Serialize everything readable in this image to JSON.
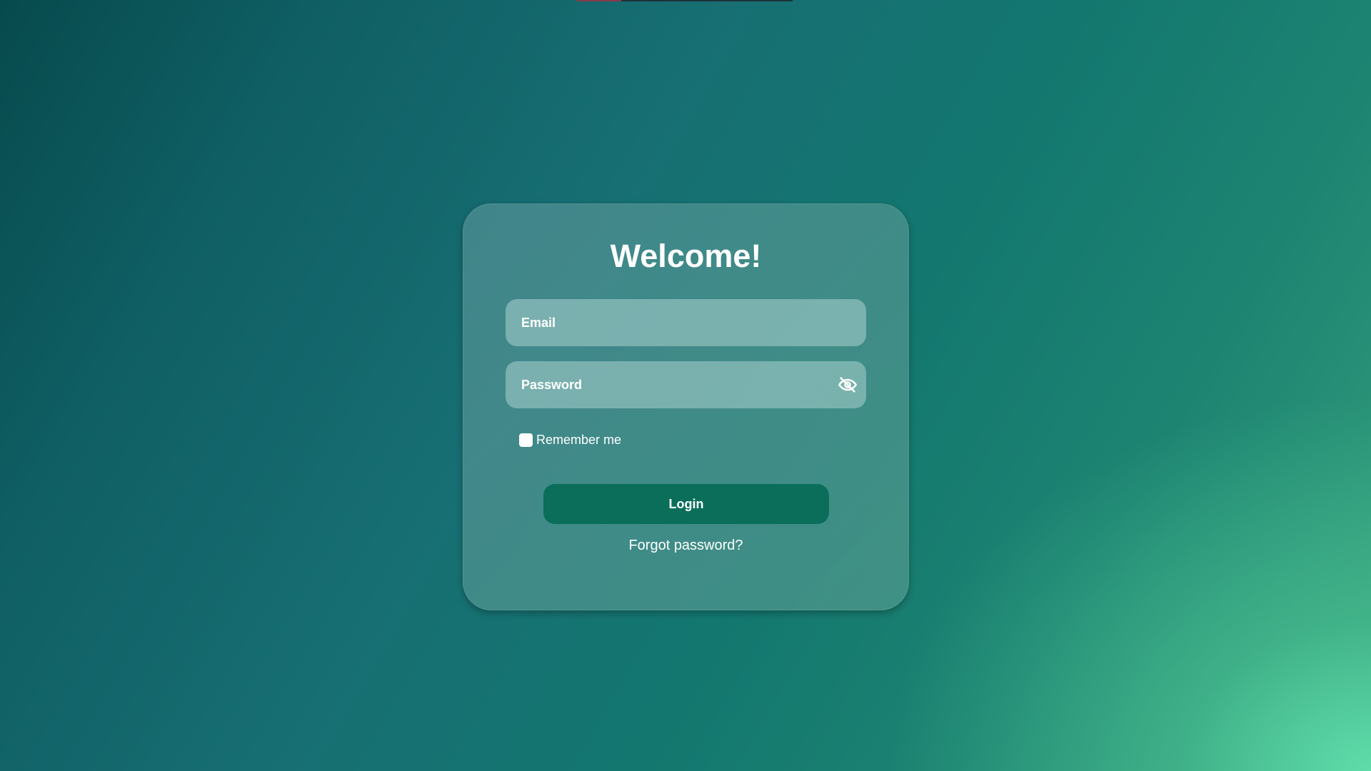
{
  "login": {
    "title": "Welcome!",
    "email": {
      "placeholder": "Email",
      "value": ""
    },
    "password": {
      "placeholder": "Password",
      "value": "",
      "toggle_icon": "eye-slash-icon"
    },
    "remember_me": {
      "label": "Remember me",
      "checked": false
    },
    "login_button_label": "Login",
    "forgot_password_label": "Forgot password?"
  },
  "colors": {
    "button": "#0a6e5a",
    "text": "#ffffff",
    "background_dark": "#074a4d",
    "background_light": "#5fdcaa"
  }
}
